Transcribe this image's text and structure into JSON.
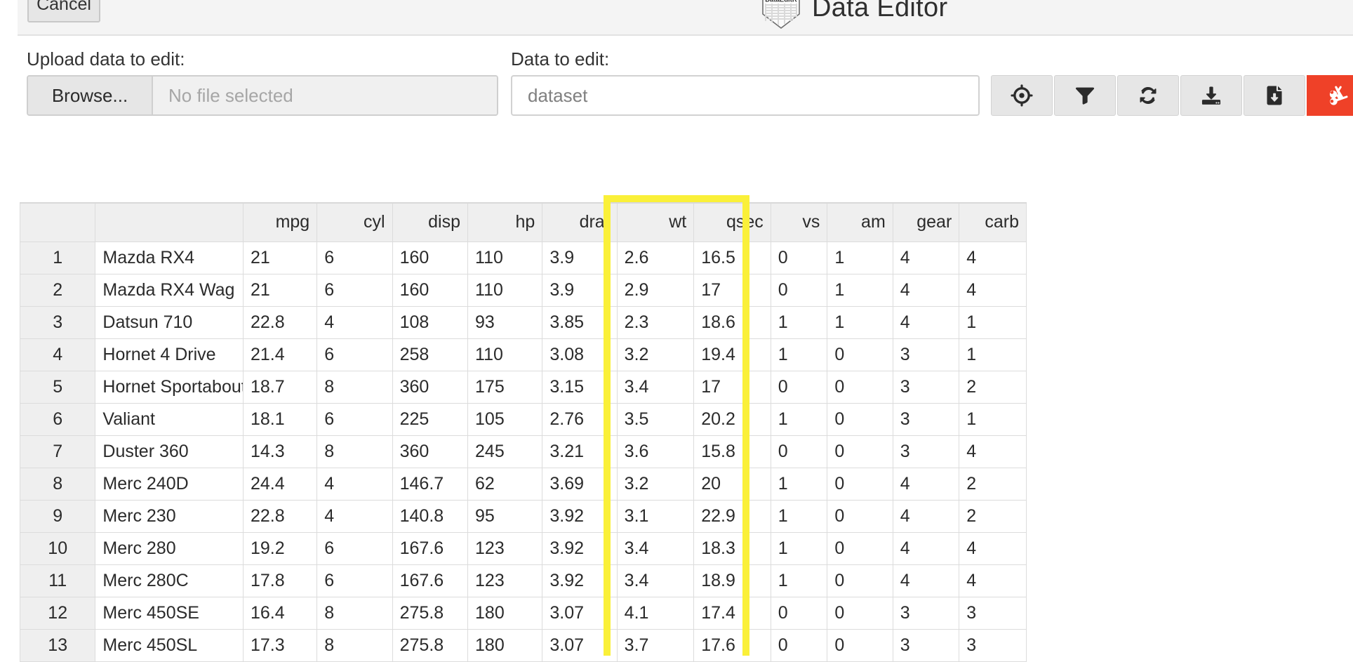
{
  "header": {
    "cancel_label": "Cancel",
    "app_title": "Data Editor",
    "logo_text": "DataEditR",
    "logo_icon": "shield-logo-icon"
  },
  "controls": {
    "upload_label": "Upload data to edit:",
    "browse_label": "Browse...",
    "file_placeholder": "No file selected",
    "file_value": "",
    "data_label": "Data to edit:",
    "dataset_placeholder": "dataset",
    "dataset_value": ""
  },
  "toolbar": {
    "buttons": [
      {
        "name": "crosshairs-icon",
        "title": "Select data",
        "style": "default"
      },
      {
        "name": "filter-icon",
        "title": "Filter data",
        "style": "default"
      },
      {
        "name": "sync-icon",
        "title": "Sync data",
        "style": "default"
      },
      {
        "name": "download-icon",
        "title": "Read data",
        "style": "default"
      },
      {
        "name": "file-download-icon",
        "title": "Save data",
        "style": "default"
      },
      {
        "name": "scissors-icon",
        "title": "Cut data",
        "style": "danger"
      }
    ],
    "danger_color": "#ef4128"
  },
  "selection": {
    "highlight_color": "#faf039",
    "columns": [
      "wt",
      "qsec"
    ]
  },
  "table": {
    "columns": [
      "",
      "",
      "mpg",
      "cyl",
      "disp",
      "hp",
      "drat",
      "wt",
      "qsec",
      "vs",
      "am",
      "gear",
      "carb"
    ],
    "rows": [
      [
        "1",
        "Mazda RX4",
        "21",
        "6",
        "160",
        "110",
        "3.9",
        "2.6",
        "16.5",
        "0",
        "1",
        "4",
        "4"
      ],
      [
        "2",
        "Mazda RX4 Wag",
        "21",
        "6",
        "160",
        "110",
        "3.9",
        "2.9",
        "17",
        "0",
        "1",
        "4",
        "4"
      ],
      [
        "3",
        "Datsun 710",
        "22.8",
        "4",
        "108",
        "93",
        "3.85",
        "2.3",
        "18.6",
        "1",
        "1",
        "4",
        "1"
      ],
      [
        "4",
        "Hornet 4 Drive",
        "21.4",
        "6",
        "258",
        "110",
        "3.08",
        "3.2",
        "19.4",
        "1",
        "0",
        "3",
        "1"
      ],
      [
        "5",
        "Hornet Sportabout",
        "18.7",
        "8",
        "360",
        "175",
        "3.15",
        "3.4",
        "17",
        "0",
        "0",
        "3",
        "2"
      ],
      [
        "6",
        "Valiant",
        "18.1",
        "6",
        "225",
        "105",
        "2.76",
        "3.5",
        "20.2",
        "1",
        "0",
        "3",
        "1"
      ],
      [
        "7",
        "Duster 360",
        "14.3",
        "8",
        "360",
        "245",
        "3.21",
        "3.6",
        "15.8",
        "0",
        "0",
        "3",
        "4"
      ],
      [
        "8",
        "Merc 240D",
        "24.4",
        "4",
        "146.7",
        "62",
        "3.69",
        "3.2",
        "20",
        "1",
        "0",
        "4",
        "2"
      ],
      [
        "9",
        "Merc 230",
        "22.8",
        "4",
        "140.8",
        "95",
        "3.92",
        "3.1",
        "22.9",
        "1",
        "0",
        "4",
        "2"
      ],
      [
        "10",
        "Merc 280",
        "19.2",
        "6",
        "167.6",
        "123",
        "3.92",
        "3.4",
        "18.3",
        "1",
        "0",
        "4",
        "4"
      ],
      [
        "11",
        "Merc 280C",
        "17.8",
        "6",
        "167.6",
        "123",
        "3.92",
        "3.4",
        "18.9",
        "1",
        "0",
        "4",
        "4"
      ],
      [
        "12",
        "Merc 450SE",
        "16.4",
        "8",
        "275.8",
        "180",
        "3.07",
        "4.1",
        "17.4",
        "0",
        "0",
        "3",
        "3"
      ],
      [
        "13",
        "Merc 450SL",
        "17.3",
        "8",
        "275.8",
        "180",
        "3.07",
        "3.7",
        "17.6",
        "0",
        "0",
        "3",
        "3"
      ]
    ]
  }
}
